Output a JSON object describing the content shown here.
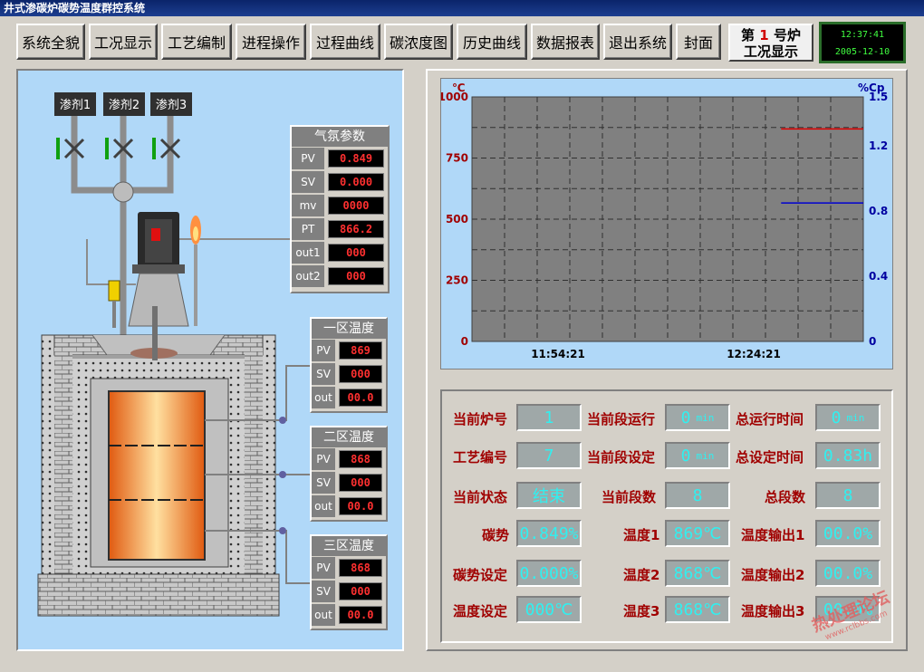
{
  "app": {
    "title": "井式渗碳炉碳势温度群控系统"
  },
  "toolbar": {
    "buttons": [
      "系统全貌",
      "工况显示",
      "工艺编制",
      "进程操作",
      "过程曲线",
      "碳浓度图",
      "历史曲线",
      "数据报表",
      "退出系统",
      "封面"
    ],
    "furnace_prefix": "第",
    "furnace_no": "1",
    "furnace_suffix": "号炉",
    "furnace_caption": "工况显示",
    "time": "12:37:41",
    "date": "2005-12-10"
  },
  "diagram": {
    "agents": [
      "渗剂1",
      "渗剂2",
      "渗剂3"
    ],
    "atmosphere": {
      "title": "气氛参数",
      "rows": [
        {
          "label": "PV",
          "value": "0.849"
        },
        {
          "label": "SV",
          "value": "0.000"
        },
        {
          "label": "mv",
          "value": "0000"
        },
        {
          "label": "PT",
          "value": "866.2"
        },
        {
          "label": "out1",
          "value": "000"
        },
        {
          "label": "out2",
          "value": "000"
        }
      ]
    },
    "zones": [
      {
        "title": "一区温度",
        "rows": [
          {
            "label": "PV",
            "value": "869"
          },
          {
            "label": "SV",
            "value": "000"
          },
          {
            "label": "out",
            "value": "00.0"
          }
        ]
      },
      {
        "title": "二区温度",
        "rows": [
          {
            "label": "PV",
            "value": "868"
          },
          {
            "label": "SV",
            "value": "000"
          },
          {
            "label": "out",
            "value": "00.0"
          }
        ]
      },
      {
        "title": "三区温度",
        "rows": [
          {
            "label": "PV",
            "value": "868"
          },
          {
            "label": "SV",
            "value": "000"
          },
          {
            "label": "out",
            "value": "00.0"
          }
        ]
      }
    ]
  },
  "chart_data": {
    "type": "line",
    "left_axis": {
      "unit": "℃",
      "ticks": [
        "1000",
        "750",
        "500",
        "250",
        "0"
      ],
      "range": [
        0,
        1000
      ],
      "color": "#a00000"
    },
    "right_axis": {
      "unit": "%Cp",
      "ticks": [
        "1.5",
        "1.2",
        "0.8",
        "0.4",
        "0"
      ],
      "range": [
        0,
        1.5
      ],
      "color": "#0000a0"
    },
    "x_ticks": [
      "11:54:21",
      "12:24:21"
    ],
    "grid": true,
    "series": [
      {
        "axis": "left",
        "color": "#e00000",
        "x": [
          0.79,
          1.0
        ],
        "values": [
          869,
          869
        ]
      },
      {
        "axis": "right",
        "color": "#0000d0",
        "x": [
          0.79,
          1.0
        ],
        "values": [
          0.849,
          0.849
        ]
      }
    ]
  },
  "info": {
    "labels": {
      "furnace_no": "当前炉号",
      "cur_seg_run": "当前段运行",
      "total_run": "总运行时间",
      "process_no": "工艺编号",
      "cur_seg_set": "当前段设定",
      "total_set": "总设定时间",
      "state": "当前状态",
      "cur_seg_no": "当前段数",
      "total_seg": "总段数",
      "carbon": "碳势",
      "temp1": "温度1",
      "tout1": "温度输出1",
      "carbon_set": "碳势设定",
      "temp2": "温度2",
      "tout2": "温度输出2",
      "temp_set": "温度设定",
      "temp3": "温度3",
      "tout3": "温度输出3"
    },
    "values": {
      "furnace_no": "1",
      "cur_seg_run": "0",
      "total_run": "0",
      "process_no": "7",
      "cur_seg_set": "0",
      "total_set": "0.83h",
      "state": "结束",
      "cur_seg_no": "8",
      "total_seg": "8",
      "carbon": "0.849%",
      "temp1": "869℃",
      "tout1": "00.0%",
      "carbon_set": "0.000%",
      "temp2": "868℃",
      "tout2": "00.0%",
      "temp_set": "000℃",
      "temp3": "868℃",
      "tout3": "00.0%"
    },
    "unit_min": "min"
  },
  "watermark": {
    "text": "热处理论坛",
    "url": "www.rclbbs.com"
  }
}
